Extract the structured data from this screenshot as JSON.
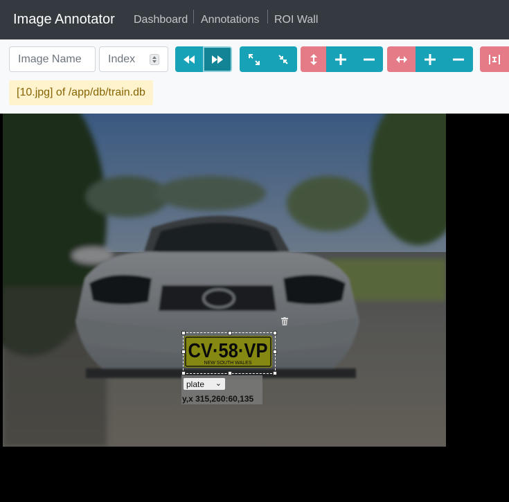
{
  "navbar": {
    "brand": "Image Annotator",
    "links": [
      "Dashboard",
      "Annotations",
      "ROI Wall"
    ]
  },
  "toolbar": {
    "image_name_placeholder": "Image Name",
    "index_placeholder": "Index",
    "icons": {
      "prev": "fast-backward-icon",
      "next": "fast-forward-icon",
      "expand": "expand-icon",
      "compress": "compress-icon",
      "vertical": "arrows-vertical-icon",
      "horizontal": "arrows-horizontal-icon",
      "plus": "plus-icon",
      "minus": "minus-icon",
      "fit": "fit-width-icon"
    },
    "status": "[10.jpg] of /app/db/train.db"
  },
  "annotation": {
    "label": "plate",
    "coords": "y,x 315,260:60,135",
    "plate_text": "CV·58·VP",
    "plate_subtext": "NEW SOUTH WALES"
  },
  "colors": {
    "navbar": "#343a40",
    "teal": "#17a2b8",
    "pink": "#e57b86",
    "badge_bg": "#fff3cd",
    "badge_text": "#856404"
  }
}
